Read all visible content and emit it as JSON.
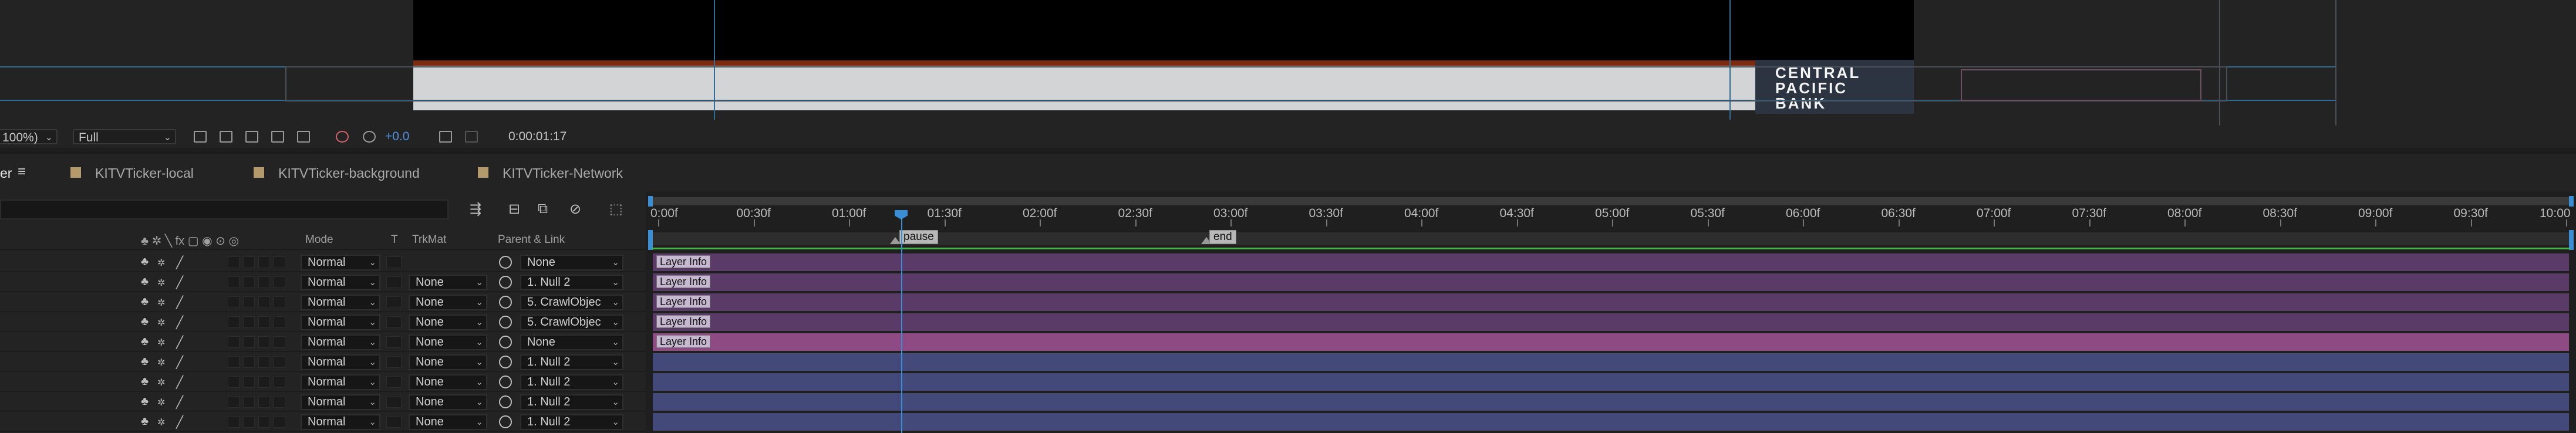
{
  "viewer": {
    "zoom": "100%)",
    "resolution": "Full",
    "exposure": "+0.0",
    "timecode": "0:00:01:17",
    "logo_lines": [
      "CENTRAL",
      "PACIFIC",
      "BANK"
    ]
  },
  "tabs": [
    {
      "label": "er",
      "active": true
    },
    {
      "label": "KITVTicker-local"
    },
    {
      "label": "KITVTicker-background"
    },
    {
      "label": "KITVTicker-Network"
    }
  ],
  "columns": {
    "mode": "Mode",
    "t": "T",
    "trkmat": "TrkMat",
    "parent": "Parent & Link"
  },
  "ruler": [
    "0:00f",
    "00:30f",
    "01:00f",
    "01:30f",
    "02:00f",
    "02:30f",
    "03:00f",
    "03:30f",
    "04:00f",
    "04:30f",
    "05:00f",
    "05:30f",
    "06:00f",
    "06:30f",
    "07:00f",
    "07:30f",
    "08:00f",
    "08:30f",
    "09:00f",
    "09:30f",
    "10:00"
  ],
  "markers": [
    {
      "label": "pause"
    },
    {
      "label": "end"
    }
  ],
  "layers": [
    {
      "mode": "Normal",
      "trkmat": "",
      "parent": "None",
      "bar_color": "#5a3a66",
      "tag": "Layer Info"
    },
    {
      "mode": "Normal",
      "trkmat": "None",
      "parent": "1. Null 2",
      "bar_color": "#5a3a66",
      "tag": "Layer Info"
    },
    {
      "mode": "Normal",
      "trkmat": "None",
      "parent": "5. CrawlObjec",
      "bar_color": "#5a3a66",
      "tag": "Layer Info"
    },
    {
      "mode": "Normal",
      "trkmat": "None",
      "parent": "5. CrawlObjec",
      "bar_color": "#5a3a66",
      "tag": "Layer Info"
    },
    {
      "mode": "Normal",
      "trkmat": "None",
      "parent": "None",
      "bar_color": "#8e4a82",
      "tag": "Layer Info"
    },
    {
      "mode": "Normal",
      "trkmat": "None",
      "parent": "1. Null 2",
      "bar_color": "#434a7a",
      "tag": ""
    },
    {
      "mode": "Normal",
      "trkmat": "None",
      "parent": "1. Null 2",
      "bar_color": "#434a7a",
      "tag": ""
    },
    {
      "mode": "Normal",
      "trkmat": "None",
      "parent": "1. Null 2",
      "bar_color": "#434a7a",
      "tag": ""
    },
    {
      "mode": "Normal",
      "trkmat": "None",
      "parent": "1. Null 2",
      "bar_color": "#434a7a",
      "tag": ""
    }
  ],
  "icons": {
    "toolbar": [
      "region-icon",
      "transparency-grid-icon",
      "mask-icon",
      "guides-icon",
      "3d-view-icon",
      "color-wheel-icon",
      "exposure-icon",
      "camera-icon",
      "snapshot-icon"
    ],
    "timeline_tools": [
      "graph-icon",
      "solo-icon",
      "frame-blend-icon",
      "motion-blur-icon",
      "graph-editor-icon"
    ]
  }
}
